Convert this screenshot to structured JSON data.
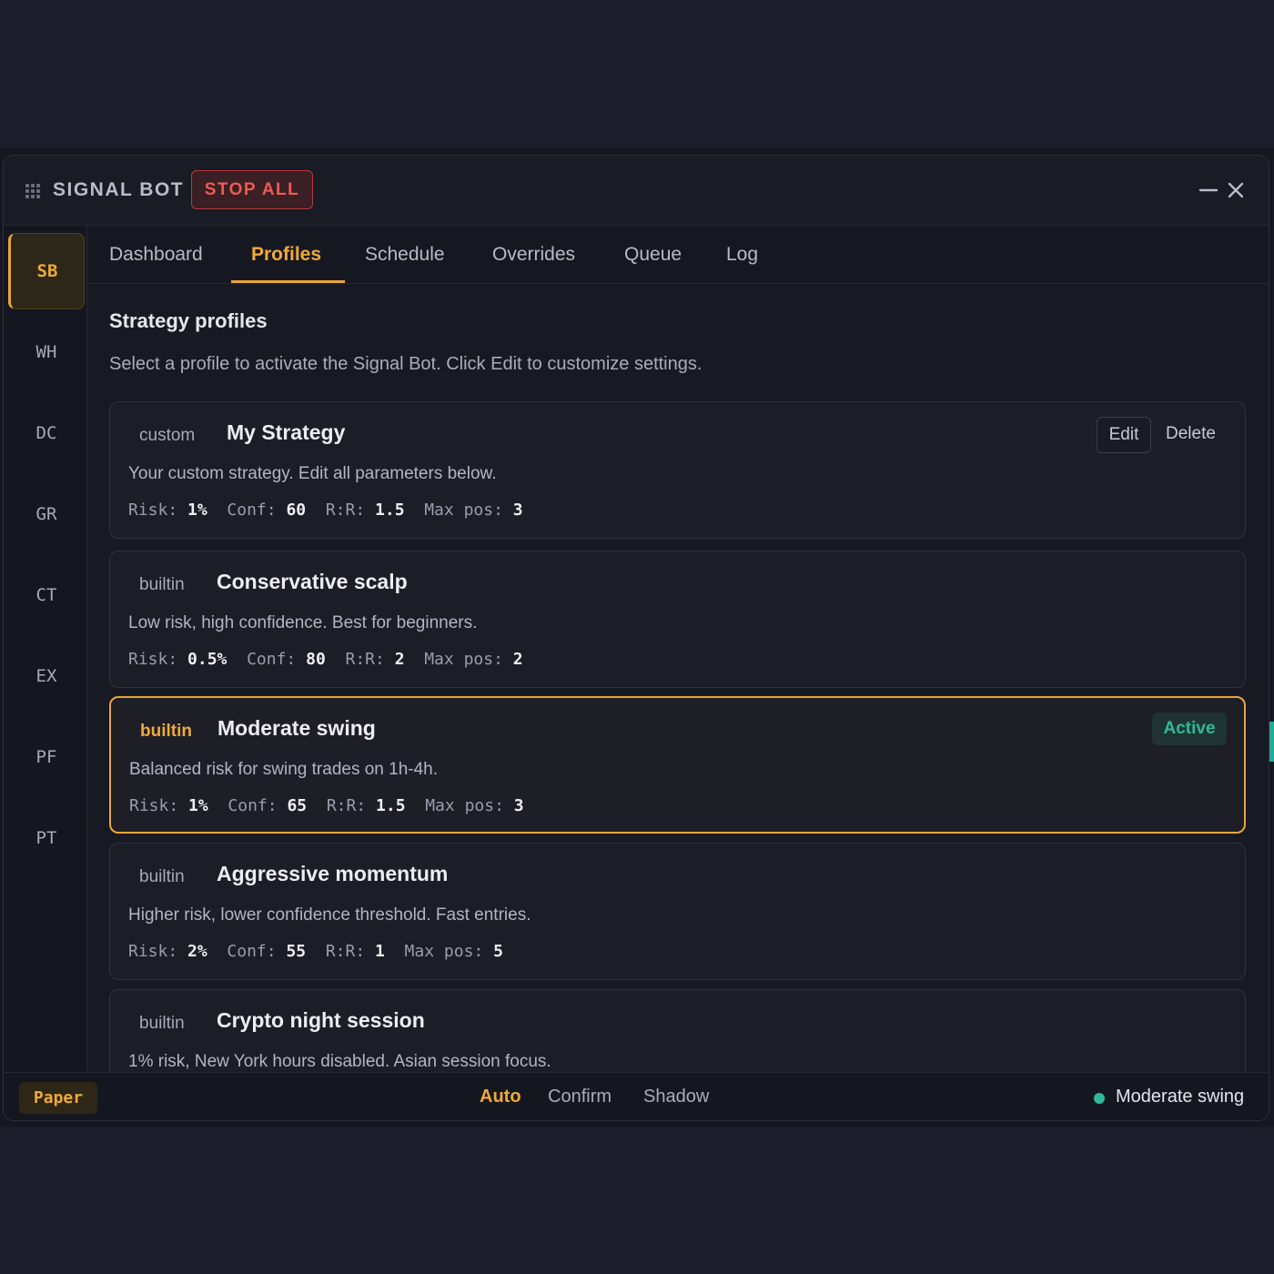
{
  "window": {
    "title": "SIGNAL BOT",
    "stop_label": "STOP ALL"
  },
  "sidebar": {
    "items": [
      {
        "label": "SB",
        "active": true
      },
      {
        "label": "WH"
      },
      {
        "label": "DC"
      },
      {
        "label": "GR"
      },
      {
        "label": "CT"
      },
      {
        "label": "EX"
      },
      {
        "label": "PF"
      },
      {
        "label": "PT"
      }
    ]
  },
  "tabs": [
    {
      "label": "Dashboard"
    },
    {
      "label": "Profiles",
      "active": true
    },
    {
      "label": "Schedule"
    },
    {
      "label": "Overrides"
    },
    {
      "label": "Queue"
    },
    {
      "label": "Log"
    }
  ],
  "section": {
    "title": "Strategy profiles",
    "subtitle": "Select a profile to activate the Signal Bot. Click Edit to customize settings."
  },
  "param_labels": {
    "risk": "Risk:",
    "conf": "Conf:",
    "rr": "R:R:",
    "max_pos": "Max pos:"
  },
  "profiles": [
    {
      "kind": "custom",
      "name": "My Strategy",
      "description": "Your custom strategy. Edit all parameters below.",
      "risk": "1%",
      "conf": "60",
      "rr": "1.5",
      "max_pos": "3",
      "edit_label": "Edit",
      "delete_label": "Delete"
    },
    {
      "kind": "builtin",
      "name": "Conservative scalp",
      "description": "Low risk, high confidence. Best for beginners.",
      "risk": "0.5%",
      "conf": "80",
      "rr": "2",
      "max_pos": "2"
    },
    {
      "kind": "builtin",
      "name": "Moderate swing",
      "description": "Balanced risk for swing trades on 1h-4h.",
      "risk": "1%",
      "conf": "65",
      "rr": "1.5",
      "max_pos": "3",
      "badge": "Active",
      "active": true
    },
    {
      "kind": "builtin",
      "name": "Aggressive momentum",
      "description": "Higher risk, lower confidence threshold. Fast entries.",
      "risk": "2%",
      "conf": "55",
      "rr": "1",
      "max_pos": "5"
    },
    {
      "kind": "builtin",
      "name": "Crypto night session",
      "description": "1% risk, New York hours disabled. Asian session focus."
    }
  ],
  "footer": {
    "account_mode": "Paper",
    "modes": [
      {
        "label": "Auto",
        "active": true
      },
      {
        "label": "Confirm"
      },
      {
        "label": "Shadow"
      }
    ],
    "status": "Moderate swing"
  },
  "colors": {
    "accent": "#e9a53b",
    "danger": "#ef5a55",
    "success": "#2fb99a"
  },
  "icons": {
    "drag": "drag-grip-icon",
    "minimize": "minimize-icon",
    "close": "close-icon"
  }
}
